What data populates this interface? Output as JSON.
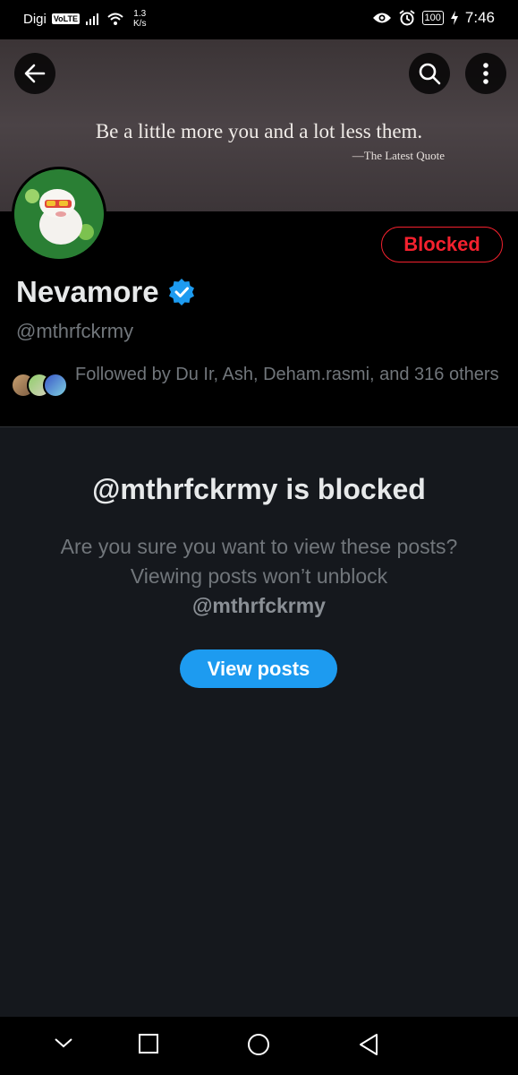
{
  "status_bar": {
    "carrier": "Digi",
    "volte": "VoLTE",
    "speed_value": "1.3",
    "speed_unit": "K/s",
    "battery": "100",
    "time": "7:46"
  },
  "banner": {
    "quote": "Be a little more you and a lot less them.",
    "attribution": "—The Latest Quote"
  },
  "profile": {
    "display_name": "Nevamore",
    "handle": "@mthrfckrmy",
    "blocked_label": "Blocked",
    "followed_by": "Followed by Du Ir, Ash, Deham.rasmi, and 316 others"
  },
  "blocked_notice": {
    "title": "@mthrfckrmy is blocked",
    "message": "Are you sure you want to view these posts? Viewing posts won’t unblock",
    "message_handle": "@mthrfckrmy",
    "view_button": "View posts"
  },
  "colors": {
    "accent": "#1d9bf0",
    "blocked_red": "#f4212e",
    "background": "#15181d"
  }
}
